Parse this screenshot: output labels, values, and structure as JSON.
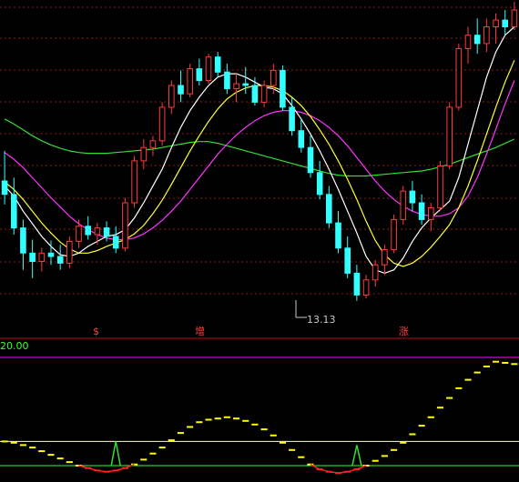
{
  "chart_data": [
    {
      "type": "candlestick",
      "title": "",
      "annotations": {
        "low_marker": "13.13"
      },
      "colors": {
        "up": "#ff3b3b",
        "down": "#33ffff",
        "ma_short": "#ffffff",
        "ma_mid": "#ffff33",
        "ma_long": "#ff33ff",
        "ma_xlong": "#33dd33",
        "grid": "#8b1a1a"
      },
      "grid": true,
      "candles": [
        {
          "o": 14.56,
          "h": 14.92,
          "l": 14.28,
          "c": 14.4
        },
        {
          "o": 14.4,
          "h": 14.6,
          "l": 13.92,
          "c": 14.0
        },
        {
          "o": 14.0,
          "h": 14.1,
          "l": 13.5,
          "c": 13.7
        },
        {
          "o": 13.7,
          "h": 13.86,
          "l": 13.4,
          "c": 13.6
        },
        {
          "o": 13.6,
          "h": 13.76,
          "l": 13.48,
          "c": 13.7
        },
        {
          "o": 13.7,
          "h": 13.85,
          "l": 13.56,
          "c": 13.66
        },
        {
          "o": 13.66,
          "h": 13.8,
          "l": 13.5,
          "c": 13.58
        },
        {
          "o": 13.58,
          "h": 13.9,
          "l": 13.52,
          "c": 13.84
        },
        {
          "o": 13.84,
          "h": 14.1,
          "l": 13.76,
          "c": 14.02
        },
        {
          "o": 14.02,
          "h": 14.14,
          "l": 13.86,
          "c": 13.92
        },
        {
          "o": 13.92,
          "h": 14.06,
          "l": 13.8,
          "c": 14.0
        },
        {
          "o": 14.0,
          "h": 14.08,
          "l": 13.84,
          "c": 13.9
        },
        {
          "o": 13.9,
          "h": 14.02,
          "l": 13.7,
          "c": 13.76
        },
        {
          "o": 13.76,
          "h": 14.36,
          "l": 13.72,
          "c": 14.3
        },
        {
          "o": 14.3,
          "h": 14.86,
          "l": 14.24,
          "c": 14.8
        },
        {
          "o": 14.8,
          "h": 15.06,
          "l": 14.7,
          "c": 14.96
        },
        {
          "o": 14.96,
          "h": 15.1,
          "l": 14.86,
          "c": 15.04
        },
        {
          "o": 15.04,
          "h": 15.5,
          "l": 14.98,
          "c": 15.44
        },
        {
          "o": 15.44,
          "h": 15.76,
          "l": 15.36,
          "c": 15.7
        },
        {
          "o": 15.7,
          "h": 15.88,
          "l": 15.5,
          "c": 15.6
        },
        {
          "o": 15.6,
          "h": 15.96,
          "l": 15.56,
          "c": 15.9
        },
        {
          "o": 15.9,
          "h": 16.02,
          "l": 15.7,
          "c": 15.76
        },
        {
          "o": 15.76,
          "h": 16.08,
          "l": 15.72,
          "c": 16.04
        },
        {
          "o": 16.04,
          "h": 16.1,
          "l": 15.8,
          "c": 15.86
        },
        {
          "o": 15.86,
          "h": 15.96,
          "l": 15.6,
          "c": 15.66
        },
        {
          "o": 15.66,
          "h": 15.84,
          "l": 15.5,
          "c": 15.72
        },
        {
          "o": 15.72,
          "h": 15.92,
          "l": 15.6,
          "c": 15.7
        },
        {
          "o": 15.7,
          "h": 15.8,
          "l": 15.46,
          "c": 15.5
        },
        {
          "o": 15.5,
          "h": 15.76,
          "l": 15.44,
          "c": 15.7
        },
        {
          "o": 15.7,
          "h": 15.96,
          "l": 15.6,
          "c": 15.88
        },
        {
          "o": 15.88,
          "h": 15.94,
          "l": 15.4,
          "c": 15.44
        },
        {
          "o": 15.44,
          "h": 15.56,
          "l": 15.1,
          "c": 15.16
        },
        {
          "o": 15.16,
          "h": 15.3,
          "l": 14.9,
          "c": 14.96
        },
        {
          "o": 14.96,
          "h": 15.1,
          "l": 14.6,
          "c": 14.66
        },
        {
          "o": 14.66,
          "h": 14.8,
          "l": 14.34,
          "c": 14.4
        },
        {
          "o": 14.4,
          "h": 14.5,
          "l": 14.0,
          "c": 14.06
        },
        {
          "o": 14.06,
          "h": 14.2,
          "l": 13.7,
          "c": 13.76
        },
        {
          "o": 13.76,
          "h": 13.9,
          "l": 13.4,
          "c": 13.46
        },
        {
          "o": 13.46,
          "h": 13.56,
          "l": 13.13,
          "c": 13.2
        },
        {
          "o": 13.2,
          "h": 13.44,
          "l": 13.16,
          "c": 13.38
        },
        {
          "o": 13.38,
          "h": 13.62,
          "l": 13.3,
          "c": 13.56
        },
        {
          "o": 13.56,
          "h": 13.8,
          "l": 13.44,
          "c": 13.74
        },
        {
          "o": 13.74,
          "h": 14.16,
          "l": 13.7,
          "c": 14.1
        },
        {
          "o": 14.1,
          "h": 14.5,
          "l": 14.04,
          "c": 14.44
        },
        {
          "o": 14.44,
          "h": 14.56,
          "l": 14.2,
          "c": 14.3
        },
        {
          "o": 14.3,
          "h": 14.4,
          "l": 14.04,
          "c": 14.1
        },
        {
          "o": 14.1,
          "h": 14.3,
          "l": 13.96,
          "c": 14.24
        },
        {
          "o": 14.24,
          "h": 14.8,
          "l": 14.2,
          "c": 14.74
        },
        {
          "o": 14.74,
          "h": 15.5,
          "l": 14.7,
          "c": 15.44
        },
        {
          "o": 15.44,
          "h": 16.2,
          "l": 15.4,
          "c": 16.14
        },
        {
          "o": 16.14,
          "h": 16.4,
          "l": 15.96,
          "c": 16.3
        },
        {
          "o": 16.3,
          "h": 16.5,
          "l": 16.08,
          "c": 16.2
        },
        {
          "o": 16.2,
          "h": 16.5,
          "l": 16.1,
          "c": 16.4
        },
        {
          "o": 16.4,
          "h": 16.56,
          "l": 16.2,
          "c": 16.48
        },
        {
          "o": 16.48,
          "h": 16.6,
          "l": 16.3,
          "c": 16.4
        },
        {
          "o": 16.4,
          "h": 16.7,
          "l": 16.36,
          "c": 16.6
        }
      ],
      "ma_short": [
        14.5,
        14.38,
        14.2,
        14.05,
        13.9,
        13.78,
        13.68,
        13.66,
        13.7,
        13.78,
        13.84,
        13.9,
        13.92,
        13.98,
        14.12,
        14.3,
        14.5,
        14.7,
        14.96,
        15.2,
        15.4,
        15.56,
        15.7,
        15.8,
        15.84,
        15.84,
        15.8,
        15.74,
        15.68,
        15.66,
        15.6,
        15.46,
        15.3,
        15.12,
        14.92,
        14.7,
        14.46,
        14.2,
        13.94,
        13.66,
        13.5,
        13.46,
        13.5,
        13.64,
        13.84,
        14.0,
        14.12,
        14.22,
        14.32,
        14.6,
        15.0,
        15.4,
        15.8,
        16.1,
        16.3,
        16.4
      ],
      "ma_mid": [
        14.55,
        14.46,
        14.34,
        14.2,
        14.06,
        13.94,
        13.83,
        13.75,
        13.7,
        13.7,
        13.73,
        13.78,
        13.82,
        13.86,
        13.93,
        14.03,
        14.17,
        14.33,
        14.52,
        14.72,
        14.92,
        15.1,
        15.27,
        15.42,
        15.54,
        15.62,
        15.67,
        15.7,
        15.7,
        15.68,
        15.64,
        15.56,
        15.46,
        15.33,
        15.17,
        15.0,
        14.8,
        14.58,
        14.34,
        14.08,
        13.85,
        13.68,
        13.58,
        13.54,
        13.58,
        13.66,
        13.77,
        13.9,
        14.04,
        14.24,
        14.5,
        14.8,
        15.12,
        15.44,
        15.74,
        16.0
      ],
      "ma_long": [
        14.9,
        14.82,
        14.72,
        14.6,
        14.48,
        14.36,
        14.25,
        14.14,
        14.05,
        13.98,
        13.92,
        13.88,
        13.86,
        13.86,
        13.88,
        13.93,
        14.0,
        14.09,
        14.2,
        14.32,
        14.46,
        14.6,
        14.74,
        14.88,
        15.0,
        15.11,
        15.2,
        15.28,
        15.34,
        15.38,
        15.4,
        15.4,
        15.38,
        15.34,
        15.28,
        15.2,
        15.1,
        14.98,
        14.84,
        14.7,
        14.56,
        14.44,
        14.34,
        14.26,
        14.2,
        14.16,
        14.14,
        14.14,
        14.17,
        14.24,
        14.38,
        14.6,
        14.88,
        15.18,
        15.48,
        15.76
      ],
      "ma_xlong": [
        15.3,
        15.24,
        15.17,
        15.1,
        15.04,
        14.99,
        14.95,
        14.92,
        14.9,
        14.89,
        14.89,
        14.89,
        14.9,
        14.91,
        14.92,
        14.93,
        14.94,
        14.96,
        14.98,
        15.0,
        15.02,
        15.03,
        15.03,
        15.01,
        14.98,
        14.95,
        14.92,
        14.89,
        14.86,
        14.83,
        14.8,
        14.77,
        14.74,
        14.71,
        14.68,
        14.65,
        14.63,
        14.62,
        14.62,
        14.62,
        14.63,
        14.64,
        14.65,
        14.66,
        14.67,
        14.68,
        14.7,
        14.73,
        14.76,
        14.8,
        14.84,
        14.88,
        14.92,
        14.96,
        15.01,
        15.06
      ],
      "price_range": [
        12.9,
        16.72
      ],
      "signals": [
        {
          "index": 10,
          "text": "$"
        },
        {
          "index": 21,
          "text": "增"
        },
        {
          "index": 43,
          "text": "涨"
        }
      ]
    },
    {
      "type": "line",
      "title": "",
      "value_label": "20.00",
      "ylim": [
        -12,
        88
      ],
      "levels": [
        0,
        20
      ],
      "colors": {
        "main": "#ffff00",
        "negative": "#ff2020",
        "spike": "#33dd33",
        "upper_level": "#ffffcc",
        "lower_level": "#33ff33",
        "sep": "#ff00ff"
      },
      "series": [
        {
          "values": [
            20,
            19,
            17,
            15,
            12,
            9,
            6,
            3,
            0,
            -2,
            -4,
            -5,
            -4,
            -2,
            1,
            5,
            10,
            15,
            21,
            27,
            32,
            36,
            38,
            39,
            40,
            39,
            37,
            34,
            30,
            25,
            19,
            13,
            7,
            1,
            -3,
            -5,
            -6,
            -5,
            -3,
            0,
            4,
            8,
            13,
            19,
            26,
            33,
            40,
            48,
            56,
            64,
            71,
            77,
            82,
            86,
            85,
            84
          ]
        }
      ],
      "spikes": [
        {
          "index": 12,
          "value": 20
        },
        {
          "index": 38,
          "value": 17
        }
      ]
    }
  ]
}
